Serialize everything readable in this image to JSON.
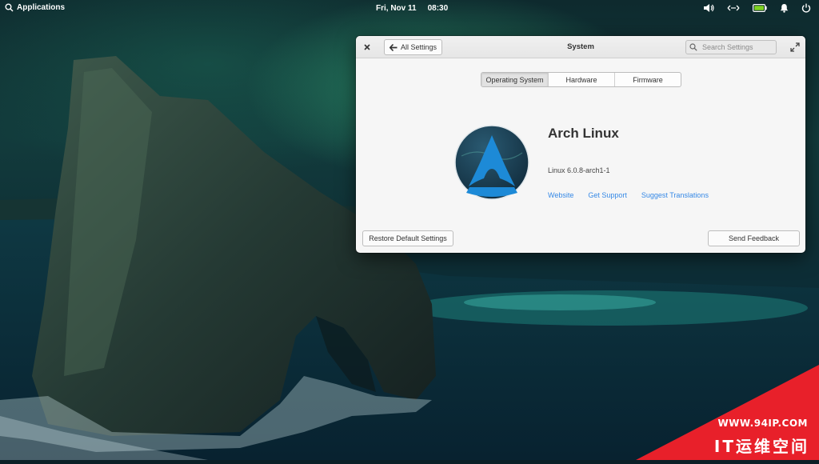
{
  "panel": {
    "applications_label": "Applications",
    "date": "Fri, Nov 11",
    "time": "08:30"
  },
  "window": {
    "title": "System",
    "back_label": "All Settings",
    "search_placeholder": "Search Settings",
    "tabs": [
      {
        "label": "Operating System",
        "active": true
      },
      {
        "label": "Hardware",
        "active": false
      },
      {
        "label": "Firmware",
        "active": false
      }
    ],
    "os_name": "Arch Linux",
    "kernel": "Linux 6.0.8-arch1-1",
    "links": {
      "website": "Website",
      "support": "Get Support",
      "translations": "Suggest Translations"
    },
    "restore_label": "Restore Default Settings",
    "feedback_label": "Send Feedback"
  },
  "watermark": {
    "url": "WWW.94IP.COM",
    "brand": "IT运维空间"
  },
  "colors": {
    "link": "#3689e6",
    "logo_blue": "#1d8ad7",
    "battery_green": "#7ed321",
    "watermark_red": "#e8202a"
  },
  "icons": {
    "search": "search-icon",
    "volume": "volume-icon",
    "network": "network-icon",
    "battery": "battery-icon",
    "notifications": "bell-icon",
    "power": "power-icon",
    "back": "arrow-left-icon",
    "close": "close-icon",
    "maximize": "maximize-icon"
  }
}
